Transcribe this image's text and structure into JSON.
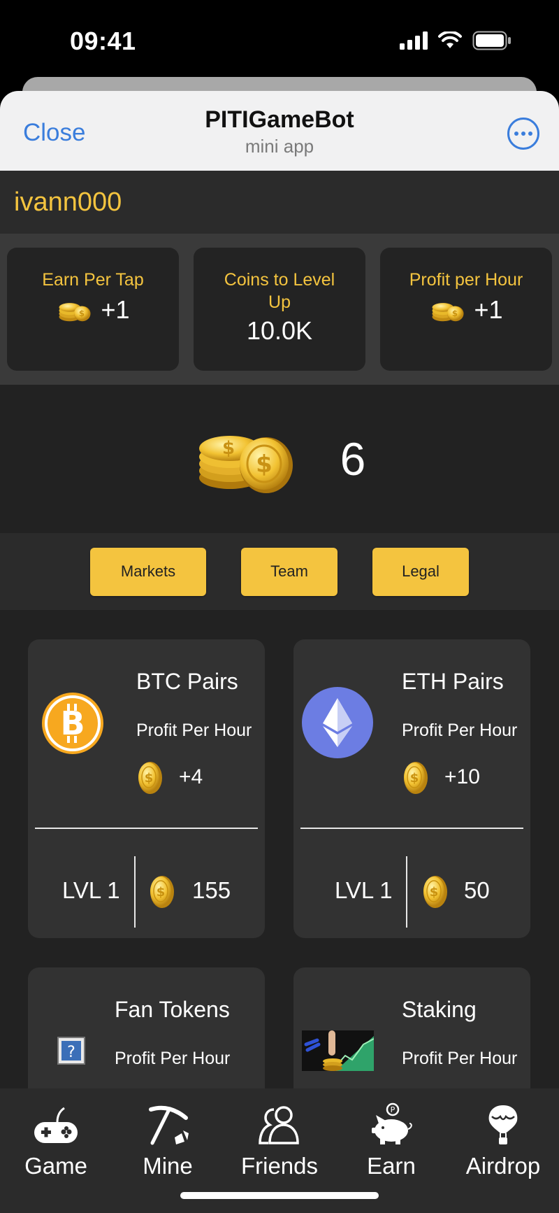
{
  "status_bar": {
    "time": "09:41"
  },
  "header": {
    "close_label": "Close",
    "title": "PITIGameBot",
    "subtitle": "mini app"
  },
  "user": {
    "name": "ivann000"
  },
  "stats": [
    {
      "label": "Earn Per Tap",
      "value": "+1",
      "icon": "coin-stack-icon"
    },
    {
      "label": "Coins to Level Up",
      "value": "10.0K"
    },
    {
      "label": "Profit per Hour",
      "value": "+1",
      "icon": "coin-stack-icon"
    }
  ],
  "balance": {
    "value": "6"
  },
  "tabs": [
    "Markets",
    "Team",
    "Legal"
  ],
  "cards": [
    {
      "title": "BTC Pairs",
      "sub": "Profit Per Hour",
      "profit": "+4",
      "level": "LVL 1",
      "cost": "155",
      "icon": "bitcoin-icon"
    },
    {
      "title": "ETH Pairs",
      "sub": "Profit Per Hour",
      "profit": "+10",
      "level": "LVL 1",
      "cost": "50",
      "icon": "ethereum-icon"
    },
    {
      "title": "Fan Tokens",
      "sub": "Profit Per Hour",
      "icon": "missing-image-icon"
    },
    {
      "title": "Staking",
      "sub": "Profit Per Hour",
      "icon": "staking-image-icon"
    }
  ],
  "nav": [
    {
      "label": "Game",
      "icon": "gamepad-icon"
    },
    {
      "label": "Mine",
      "icon": "pickaxe-icon"
    },
    {
      "label": "Friends",
      "icon": "friends-icon"
    },
    {
      "label": "Earn",
      "icon": "piggy-bank-icon"
    },
    {
      "label": "Airdrop",
      "icon": "airdrop-icon"
    }
  ],
  "colors": {
    "accent": "#f4c43f",
    "link": "#3a7ddc",
    "background": "#222222",
    "card": "#323232"
  }
}
